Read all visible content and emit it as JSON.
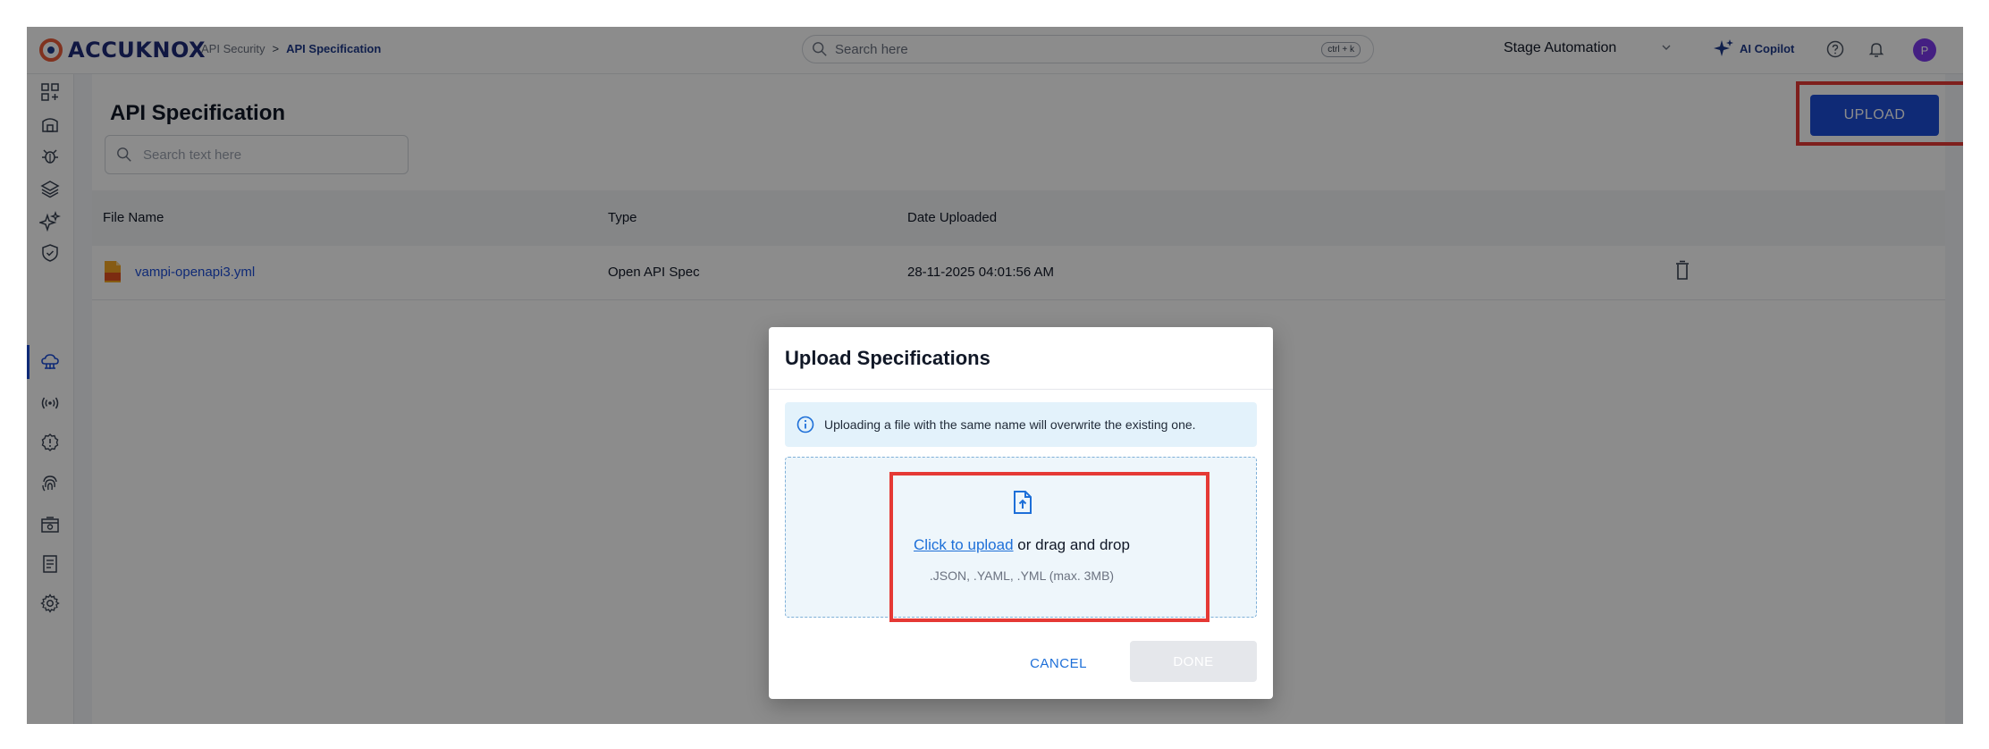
{
  "brand": {
    "logo_text": "ACCUKNOX"
  },
  "breadcrumb": {
    "parent": "API Security",
    "separator": ">",
    "current": "API Specification"
  },
  "header": {
    "search_placeholder": "Search here",
    "search_shortcut": "ctrl + k",
    "workspace": "Stage Automation",
    "copilot_label": "AI Copilot",
    "avatar_initial": "P"
  },
  "sidebar": {
    "items": [
      {
        "icon": "dashboard-add-icon"
      },
      {
        "icon": "home-icon"
      },
      {
        "icon": "bug-icon"
      },
      {
        "icon": "layers-icon"
      },
      {
        "icon": "sparkle-icon"
      },
      {
        "icon": "shield-check-icon"
      },
      {
        "icon": "api-cloud-icon",
        "active": true
      },
      {
        "icon": "radio-signal-icon"
      },
      {
        "icon": "alert-gear-icon"
      },
      {
        "icon": "fingerprint-icon"
      },
      {
        "icon": "inventory-icon"
      },
      {
        "icon": "report-icon"
      },
      {
        "icon": "settings-icon"
      }
    ]
  },
  "page": {
    "title": "API Specification",
    "search_placeholder": "Search text here",
    "upload_label": "UPLOAD"
  },
  "table": {
    "columns": [
      "File Name",
      "Type",
      "Date Uploaded"
    ],
    "rows": [
      {
        "file_name": "vampi-openapi3.yml",
        "type": "Open API Spec",
        "date_uploaded": "28-11-2025 04:01:56 AM"
      }
    ]
  },
  "modal": {
    "title": "Upload Specifications",
    "info_text": "Uploading a file with the same name will overwrite the existing one.",
    "upload_link": "Click to upload",
    "upload_rest": " or drag and drop",
    "formats_hint": ".JSON, .YAML, .YML (max. 3MB)",
    "cancel_label": "CANCEL",
    "done_label": "DONE"
  },
  "colors": {
    "primary": "#1d4ed8",
    "highlight": "#e53935",
    "info_bg": "#e3f2fb",
    "logo_orange": "#ea5b3a"
  }
}
